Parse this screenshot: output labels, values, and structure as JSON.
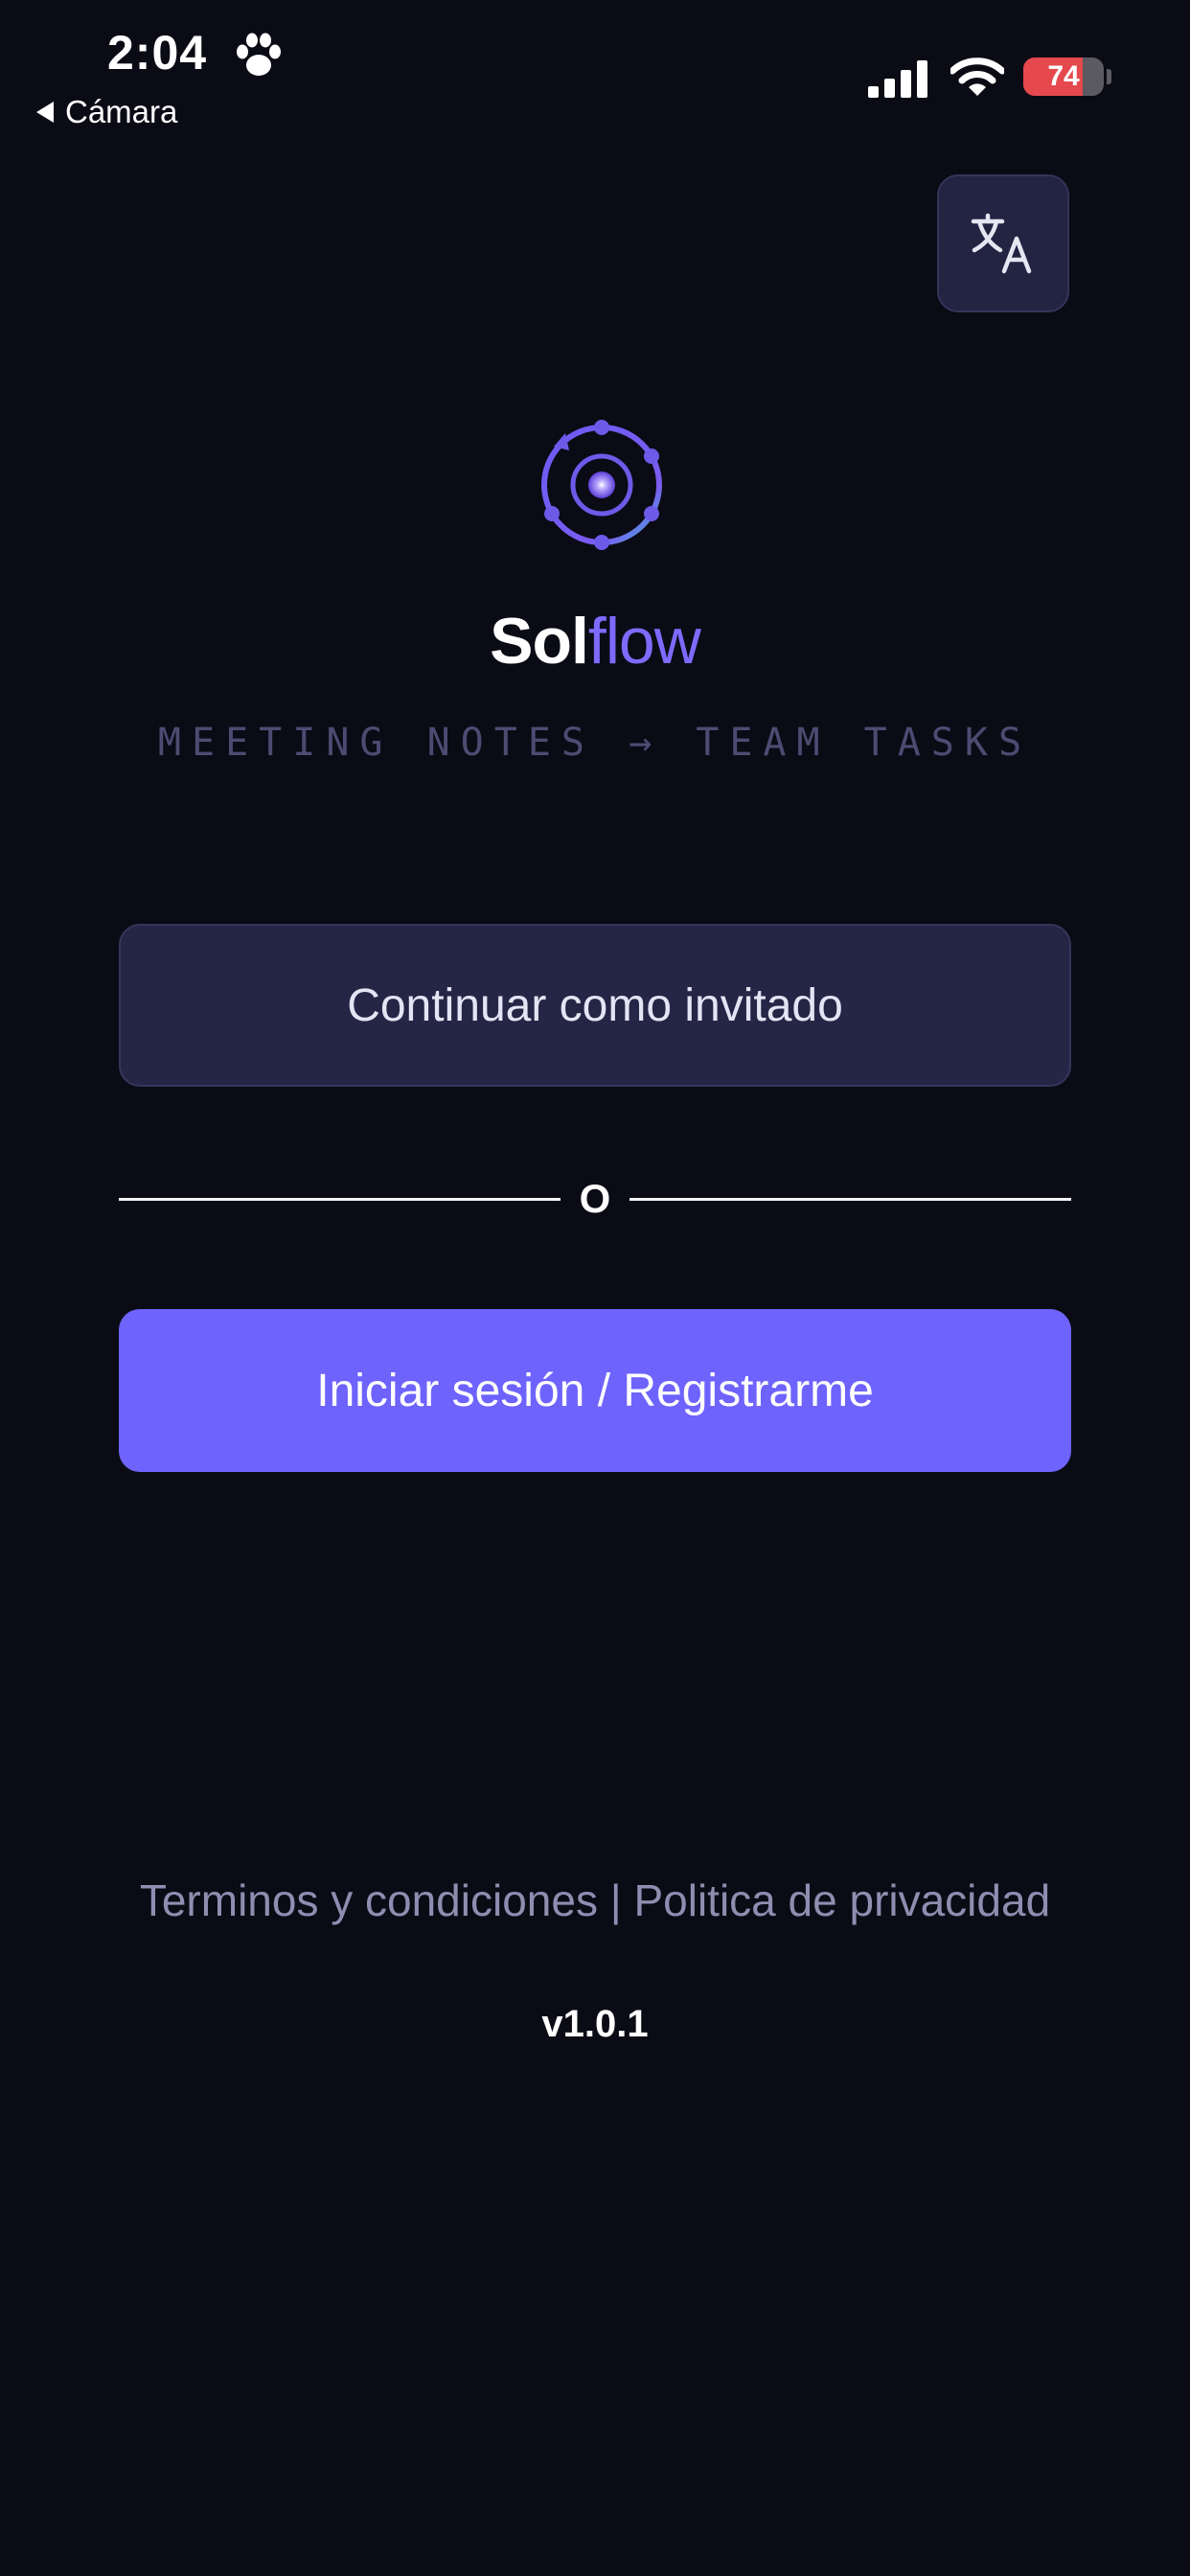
{
  "status_bar": {
    "time": "2:04",
    "time_icon": "paw-icon",
    "back_app": "Cámara",
    "battery_level": "74",
    "battery_fraction": 0.74,
    "icons": [
      "signal-icon",
      "wifi-icon",
      "battery-charging-icon"
    ]
  },
  "header": {
    "language_button_icon": "translate-icon"
  },
  "brand": {
    "name_strong": "Sol",
    "name_light": "flow",
    "tagline": "MEETING NOTES → TEAM TASKS",
    "accent_color": "#7d6bff"
  },
  "actions": {
    "guest_label": "Continuar como invitado",
    "divider_label": "O",
    "login_label": "Iniciar sesión / Registrarme",
    "login_color": "#6e63fc"
  },
  "footer": {
    "terms_label": "Terminos y condiciones",
    "separator": "|",
    "privacy_label": "Politica de privacidad",
    "version": "v1.0.1"
  }
}
